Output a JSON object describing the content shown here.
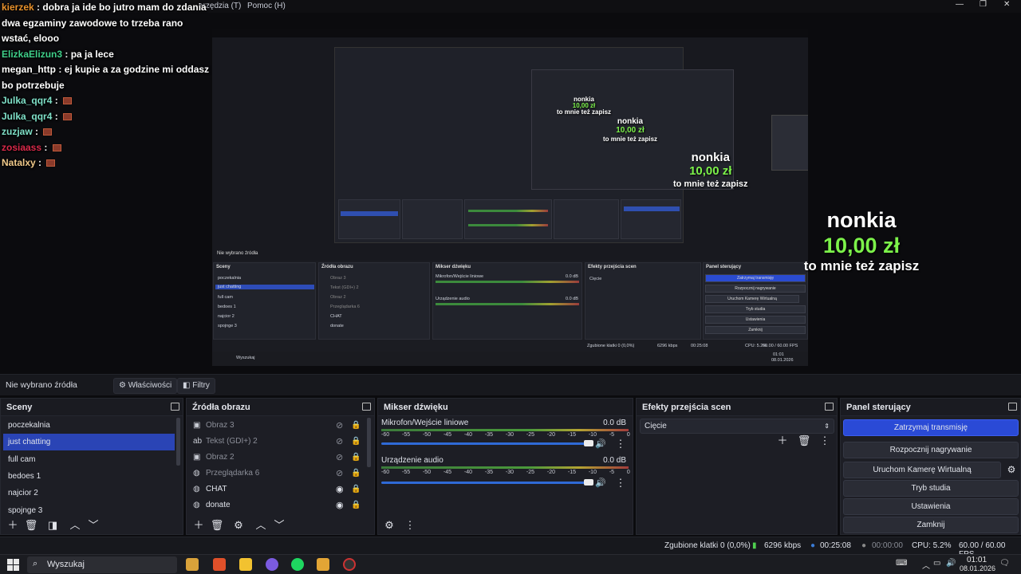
{
  "menubar": {
    "item_partial": "arzędzia (T)",
    "item_help": "Pomoc (H)"
  },
  "chat": [
    {
      "user": "kierzek",
      "color": "#e8912b",
      "message": "dobra ja ide bo jutro mam do zdania dwa egzaminy zawodowe to trzeba rano wstać, elooo",
      "emote": false
    },
    {
      "user": "ElizkaElizun3",
      "color": "#3fd08a",
      "message": "pa ja lece",
      "emote": false
    },
    {
      "user": "megan_http",
      "color": "#ffffff",
      "message": "ej kupie a za godzine mi oddasz bo potrzebuje",
      "emote": false
    },
    {
      "user": "Julka_qqr4",
      "color": "#7fe0c8",
      "message": "",
      "emote": true
    },
    {
      "user": "Julka_qqr4",
      "color": "#7fe0c8",
      "message": "",
      "emote": true
    },
    {
      "user": "zuzjaw",
      "color": "#7fe0c8",
      "message": "",
      "emote": true
    },
    {
      "user": "zosiaass",
      "color": "#d9294a",
      "message": "",
      "emote": true
    },
    {
      "user": "Natalxy",
      "color": "#f0c98a",
      "message": "",
      "emote": true
    }
  ],
  "donation": {
    "name": "nonkia",
    "amount": "10,00 zł",
    "message": "to mnie też zapisz"
  },
  "source_toolbar": {
    "label": "Nie wybrano źródła",
    "properties": "Właściwości",
    "filters": "Filtry"
  },
  "scenes": {
    "title": "Sceny",
    "items": [
      "poczekalnia",
      "just chatting",
      "full cam",
      "bedoes 1",
      "najcior 2",
      "spojnge 3"
    ],
    "selected": 1
  },
  "sources": {
    "title": "Źródła obrazu",
    "items": [
      {
        "name": "Obraz 3",
        "icon": "image-icon",
        "visible": false
      },
      {
        "name": "Tekst (GDI+) 2",
        "icon": "text-icon",
        "visible": false
      },
      {
        "name": "Obraz 2",
        "icon": "image-icon",
        "visible": false
      },
      {
        "name": "Przeglądarka 6",
        "icon": "globe-icon",
        "visible": false
      },
      {
        "name": "CHAT",
        "icon": "globe-icon",
        "visible": true
      },
      {
        "name": "donate",
        "icon": "globe-icon",
        "visible": true
      }
    ]
  },
  "mixer": {
    "title": "Mikser dźwięku",
    "scale": [
      "-60",
      "-55",
      "-50",
      "-45",
      "-40",
      "-35",
      "-30",
      "-25",
      "-20",
      "-15",
      "-10",
      "-5",
      "0"
    ],
    "channels": [
      {
        "name": "Mikrofon/Wejście liniowe",
        "db": "0.0 dB"
      },
      {
        "name": "Urządzenie audio",
        "db": "0.0 dB"
      }
    ]
  },
  "transitions": {
    "title": "Efekty przejścia scen",
    "selected": "Cięcie"
  },
  "controls": {
    "title": "Panel sterujący",
    "buttons": [
      "Zatrzymaj transmisję",
      "Rozpocznij nagrywanie",
      "Uruchom Kamerę Wirtualną",
      "Tryb studia",
      "Ustawienia",
      "Zamknij"
    ]
  },
  "status": {
    "dropped": "Zgubione klatki 0 (0,0%)",
    "bitrate": "6296 kbps",
    "stream_time": "00:25:08",
    "rec_time": "00:00:00",
    "cpu": "CPU: 5.2%",
    "fps": "60.00 / 60.00 FPS"
  },
  "taskbar": {
    "search": "Wyszukaj",
    "time": "01:01",
    "date": "08.01.2026"
  },
  "colors": {
    "accent": "#2a4ad6",
    "donation_amount": "#7cf24a"
  }
}
